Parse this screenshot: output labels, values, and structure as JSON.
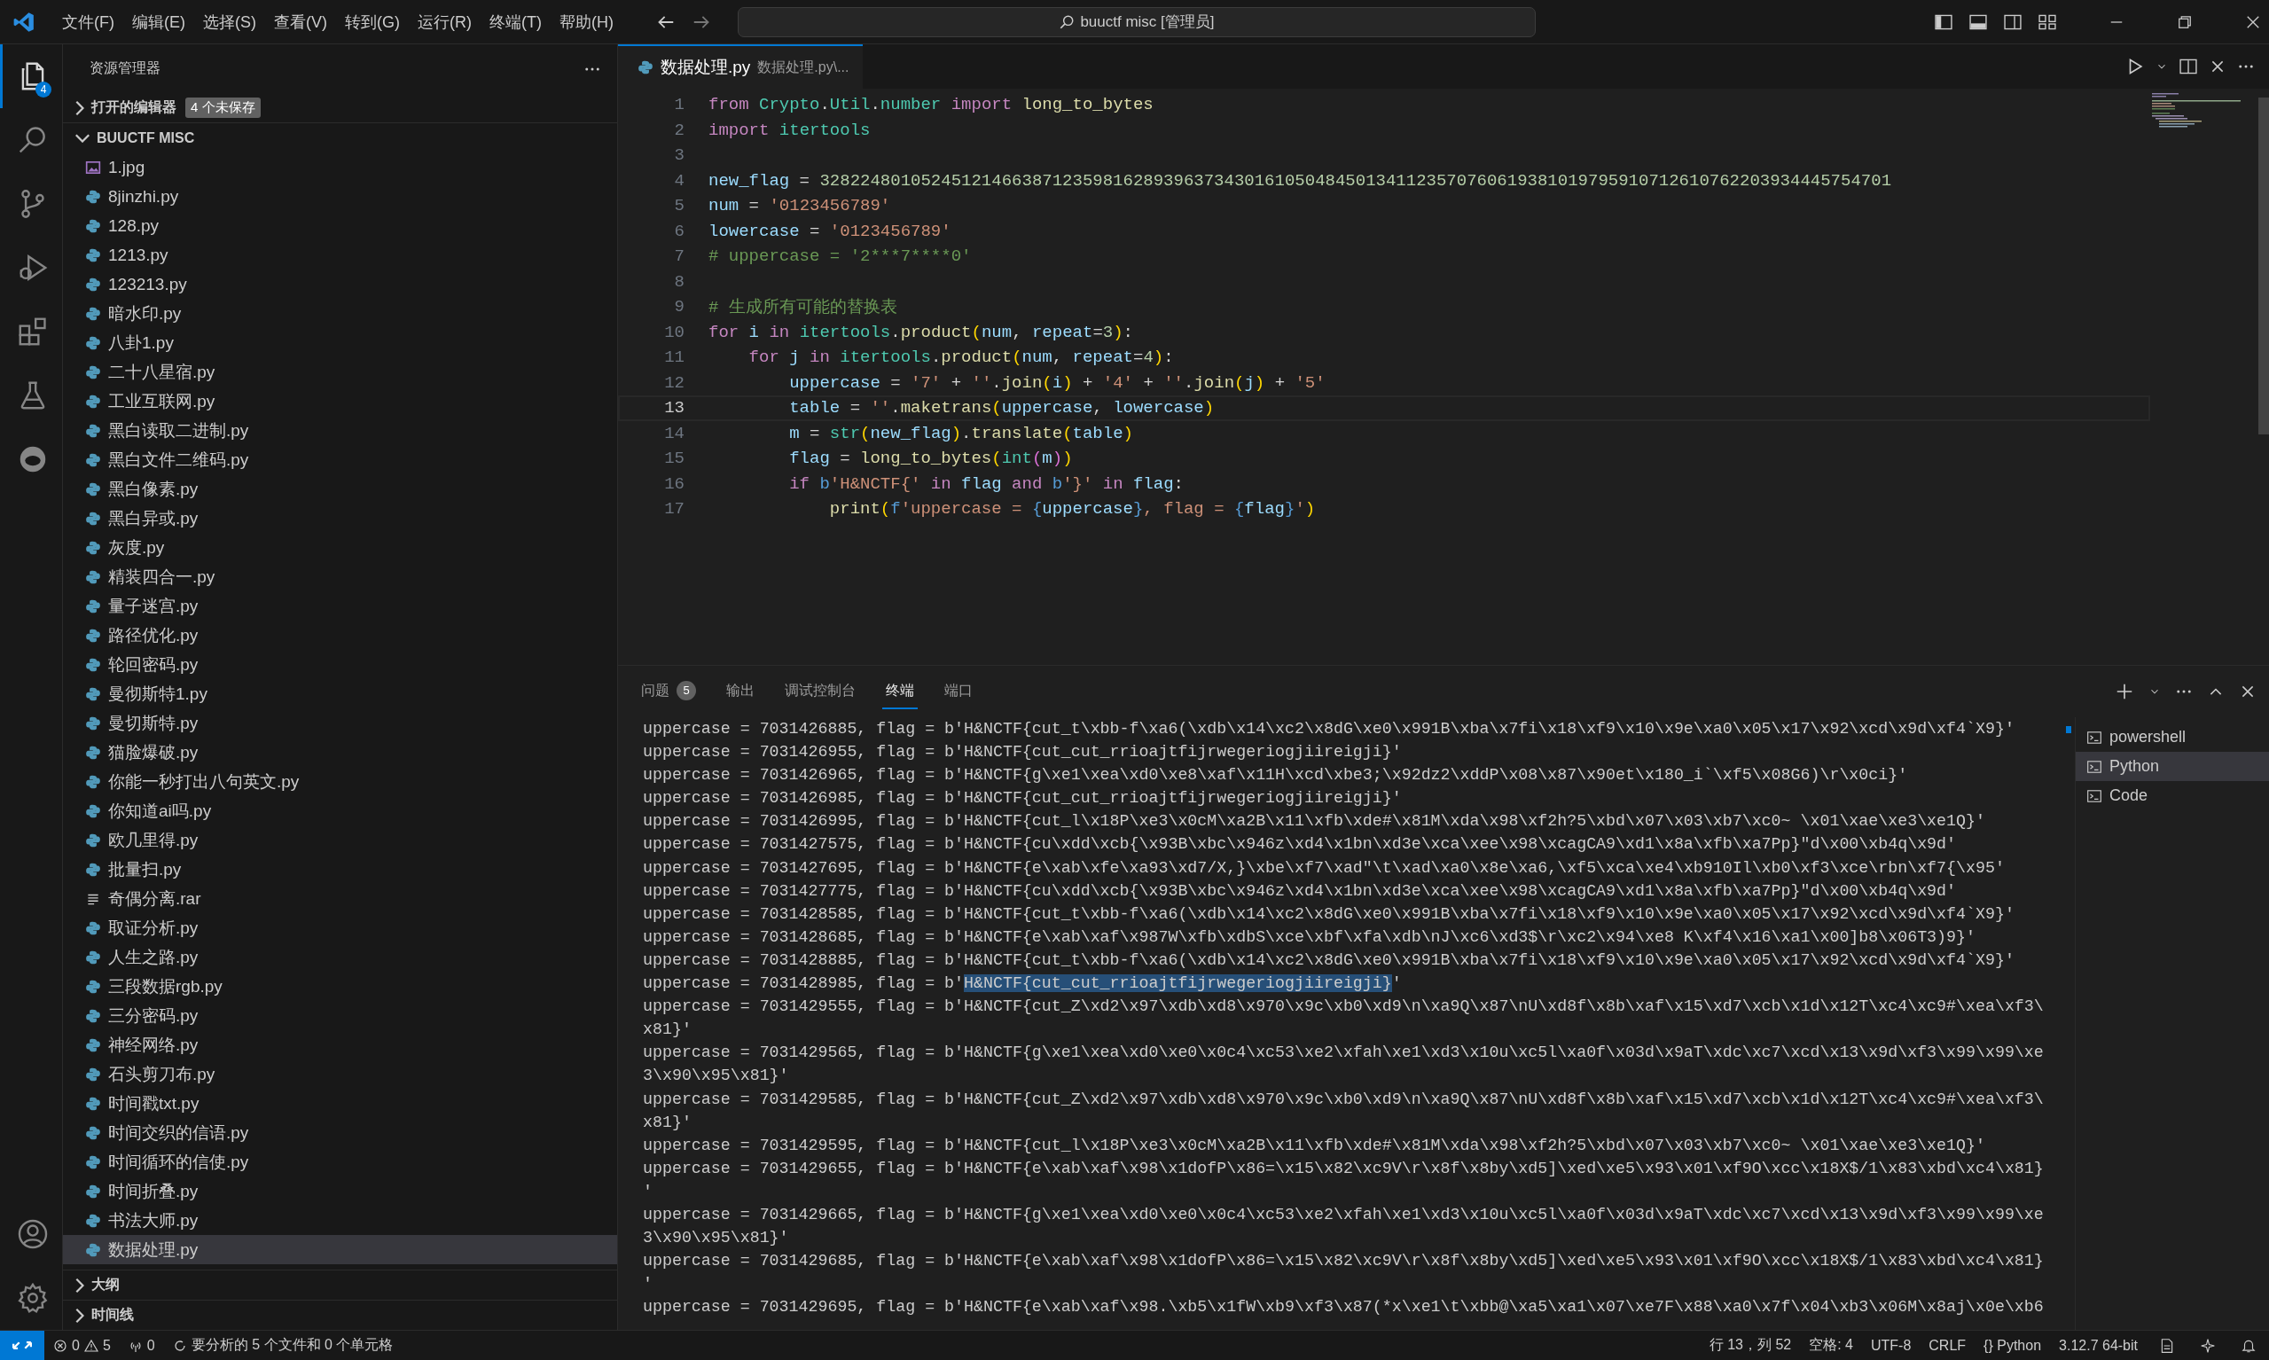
{
  "title_bar": {
    "menus": [
      "文件(F)",
      "编辑(E)",
      "选择(S)",
      "查看(V)",
      "转到(G)",
      "运行(R)",
      "终端(T)",
      "帮助(H)"
    ],
    "search": "buuctf misc [管理员]"
  },
  "activity_bar": {
    "items": [
      {
        "selected": true,
        "badge": "4"
      },
      {
        "selected": false
      },
      {
        "selected": false
      },
      {
        "selected": false
      },
      {
        "selected": false
      },
      {
        "selected": false
      },
      {
        "selected": false
      }
    ]
  },
  "sidebar": {
    "title": "资源管理器",
    "open_editors": {
      "label": "打开的编辑器",
      "badge": "4 个未保存",
      "expanded": false
    },
    "folder": {
      "label": "BUUCTF MISC",
      "expanded": true,
      "files": [
        {
          "name": "1.jpg",
          "kind": "image",
          "selected": false
        },
        {
          "name": "8jinzhi.py",
          "kind": "python",
          "selected": false
        },
        {
          "name": "128.py",
          "kind": "python",
          "selected": false
        },
        {
          "name": "1213.py",
          "kind": "python",
          "selected": false
        },
        {
          "name": "123213.py",
          "kind": "python",
          "selected": false
        },
        {
          "name": "暗水印.py",
          "kind": "python",
          "selected": false
        },
        {
          "name": "八卦1.py",
          "kind": "python",
          "selected": false
        },
        {
          "name": "二十八星宿.py",
          "kind": "python",
          "selected": false
        },
        {
          "name": "工业互联网.py",
          "kind": "python",
          "selected": false
        },
        {
          "name": "黑白读取二进制.py",
          "kind": "python",
          "selected": false
        },
        {
          "name": "黑白文件二维码.py",
          "kind": "python",
          "selected": false
        },
        {
          "name": "黑白像素.py",
          "kind": "python",
          "selected": false
        },
        {
          "name": "黑白异或.py",
          "kind": "python",
          "selected": false
        },
        {
          "name": "灰度.py",
          "kind": "python",
          "selected": false
        },
        {
          "name": "精装四合一.py",
          "kind": "python",
          "selected": false
        },
        {
          "name": "量子迷宫.py",
          "kind": "python",
          "selected": false
        },
        {
          "name": "路径优化.py",
          "kind": "python",
          "selected": false
        },
        {
          "name": "轮回密码.py",
          "kind": "python",
          "selected": false
        },
        {
          "name": "曼彻斯特1.py",
          "kind": "python",
          "selected": false
        },
        {
          "name": "曼切斯特.py",
          "kind": "python",
          "selected": false
        },
        {
          "name": "猫脸爆破.py",
          "kind": "python",
          "selected": false
        },
        {
          "name": "你能一秒打出八句英文.py",
          "kind": "python",
          "selected": false
        },
        {
          "name": "你知道ai吗.py",
          "kind": "python",
          "selected": false
        },
        {
          "name": "欧几里得.py",
          "kind": "python",
          "selected": false
        },
        {
          "name": "批量扫.py",
          "kind": "python",
          "selected": false
        },
        {
          "name": "奇偶分离.rar",
          "kind": "text",
          "selected": false
        },
        {
          "name": "取证分析.py",
          "kind": "python",
          "selected": false
        },
        {
          "name": "人生之路.py",
          "kind": "python",
          "selected": false
        },
        {
          "name": "三段数据rgb.py",
          "kind": "python",
          "selected": false
        },
        {
          "name": "三分密码.py",
          "kind": "python",
          "selected": false
        },
        {
          "name": "神经网络.py",
          "kind": "python",
          "selected": false
        },
        {
          "name": "石头剪刀布.py",
          "kind": "python",
          "selected": false
        },
        {
          "name": "时间戳txt.py",
          "kind": "python",
          "selected": false
        },
        {
          "name": "时间交织的信语.py",
          "kind": "python",
          "selected": false
        },
        {
          "name": "时间循环的信使.py",
          "kind": "python",
          "selected": false
        },
        {
          "name": "时间折叠.py",
          "kind": "python",
          "selected": false
        },
        {
          "name": "书法大师.py",
          "kind": "python",
          "selected": false
        },
        {
          "name": "数据处理.py",
          "kind": "python",
          "selected": true
        }
      ]
    },
    "sections": [
      {
        "label": "大纲",
        "expanded": false
      },
      {
        "label": "时间线",
        "expanded": false
      }
    ]
  },
  "editor": {
    "tab": {
      "title": "数据处理.py",
      "description": "数据处理.py\\..."
    },
    "lines": [
      {
        "number": "1",
        "current": false,
        "tokens": [
          {
            "text": "from",
            "kind": "keyword"
          },
          {
            "text": " Crypto",
            "kind": "module"
          },
          {
            "text": ".",
            "kind": "plain"
          },
          {
            "text": "Util",
            "kind": "module"
          },
          {
            "text": ".",
            "kind": "plain"
          },
          {
            "text": "number",
            "kind": "module"
          },
          {
            "text": " import",
            "kind": "keyword"
          },
          {
            "text": " long_to_bytes",
            "kind": "function"
          }
        ]
      },
      {
        "number": "2",
        "current": false,
        "tokens": [
          {
            "text": "import",
            "kind": "keyword"
          },
          {
            "text": " itertools",
            "kind": "module"
          }
        ]
      },
      {
        "number": "3",
        "current": false
      },
      {
        "number": "4",
        "current": false,
        "tokens": [
          {
            "text": "new_flag",
            "kind": "variable"
          },
          {
            "text": " = ",
            "kind": "plain"
          },
          {
            "text": "3282248010524512146638712359816289396373430161050484501341123570760619381019795910712610762203934445754701",
            "kind": "number"
          }
        ]
      },
      {
        "number": "5",
        "current": false,
        "tokens": [
          {
            "text": "num",
            "kind": "variable"
          },
          {
            "text": " = ",
            "kind": "plain"
          },
          {
            "text": "'0123456789'",
            "kind": "string"
          }
        ]
      },
      {
        "number": "6",
        "current": false,
        "tokens": [
          {
            "text": "lowercase",
            "kind": "variable"
          },
          {
            "text": " = ",
            "kind": "plain"
          },
          {
            "text": "'0123456789'",
            "kind": "string"
          }
        ]
      },
      {
        "number": "7",
        "current": false,
        "tokens": [
          {
            "text": "# uppercase = '2***7****0'",
            "kind": "comment"
          }
        ]
      },
      {
        "number": "8",
        "current": false
      },
      {
        "number": "9",
        "current": false,
        "tokens": [
          {
            "text": "# 生成所有可能的替换表",
            "kind": "comment"
          }
        ]
      },
      {
        "number": "10",
        "current": false,
        "tokens": [
          {
            "text": "for",
            "kind": "keyword"
          },
          {
            "text": " i",
            "kind": "variable"
          },
          {
            "text": " in",
            "kind": "keyword"
          },
          {
            "text": " itertools",
            "kind": "module"
          },
          {
            "text": ".",
            "kind": "plain"
          },
          {
            "text": "product",
            "kind": "function"
          },
          {
            "text": "(",
            "kind": "bracket"
          },
          {
            "text": "num",
            "kind": "variable"
          },
          {
            "text": ", ",
            "kind": "plain"
          },
          {
            "text": "repeat",
            "kind": "variable"
          },
          {
            "text": "=",
            "kind": "plain"
          },
          {
            "text": "3",
            "kind": "number"
          },
          {
            "text": ")",
            "kind": "bracket"
          },
          {
            "text": ":",
            "kind": "plain"
          }
        ]
      },
      {
        "number": "11",
        "current": false,
        "tokens": [
          {
            "text": "    for",
            "kind": "keyword"
          },
          {
            "text": " j",
            "kind": "variable"
          },
          {
            "text": " in",
            "kind": "keyword"
          },
          {
            "text": " itertools",
            "kind": "module"
          },
          {
            "text": ".",
            "kind": "plain"
          },
          {
            "text": "product",
            "kind": "function"
          },
          {
            "text": "(",
            "kind": "bracket"
          },
          {
            "text": "num",
            "kind": "variable"
          },
          {
            "text": ", ",
            "kind": "plain"
          },
          {
            "text": "repeat",
            "kind": "variable"
          },
          {
            "text": "=",
            "kind": "plain"
          },
          {
            "text": "4",
            "kind": "number"
          },
          {
            "text": ")",
            "kind": "bracket"
          },
          {
            "text": ":",
            "kind": "plain"
          }
        ]
      },
      {
        "number": "12",
        "current": false,
        "tokens": [
          {
            "text": "        uppercase",
            "kind": "variable"
          },
          {
            "text": " = ",
            "kind": "plain"
          },
          {
            "text": "'7'",
            "kind": "string"
          },
          {
            "text": " + ",
            "kind": "plain"
          },
          {
            "text": "''",
            "kind": "string"
          },
          {
            "text": ".",
            "kind": "plain"
          },
          {
            "text": "join",
            "kind": "function"
          },
          {
            "text": "(",
            "kind": "bracket"
          },
          {
            "text": "i",
            "kind": "variable"
          },
          {
            "text": ")",
            "kind": "bracket"
          },
          {
            "text": " + ",
            "kind": "plain"
          },
          {
            "text": "'4'",
            "kind": "string"
          },
          {
            "text": " + ",
            "kind": "plain"
          },
          {
            "text": "''",
            "kind": "string"
          },
          {
            "text": ".",
            "kind": "plain"
          },
          {
            "text": "join",
            "kind": "function"
          },
          {
            "text": "(",
            "kind": "bracket"
          },
          {
            "text": "j",
            "kind": "variable"
          },
          {
            "text": ")",
            "kind": "bracket"
          },
          {
            "text": " + ",
            "kind": "plain"
          },
          {
            "text": "'5'",
            "kind": "string"
          }
        ]
      },
      {
        "number": "13",
        "current": true,
        "tokens": [
          {
            "text": "        table",
            "kind": "variable"
          },
          {
            "text": " = ",
            "kind": "plain"
          },
          {
            "text": "''",
            "kind": "string"
          },
          {
            "text": ".",
            "kind": "plain"
          },
          {
            "text": "maketrans",
            "kind": "function"
          },
          {
            "text": "(",
            "kind": "bracket"
          },
          {
            "text": "uppercase",
            "kind": "variable"
          },
          {
            "text": ", ",
            "kind": "plain"
          },
          {
            "text": "lowercase",
            "kind": "variable"
          },
          {
            "text": ")",
            "kind": "bracket"
          }
        ]
      },
      {
        "number": "14",
        "current": false,
        "tokens": [
          {
            "text": "        m",
            "kind": "variable"
          },
          {
            "text": " = ",
            "kind": "plain"
          },
          {
            "text": "str",
            "kind": "module"
          },
          {
            "text": "(",
            "kind": "bracket"
          },
          {
            "text": "new_flag",
            "kind": "variable"
          },
          {
            "text": ")",
            "kind": "bracket"
          },
          {
            "text": ".",
            "kind": "plain"
          },
          {
            "text": "translate",
            "kind": "function"
          },
          {
            "text": "(",
            "kind": "bracket"
          },
          {
            "text": "table",
            "kind": "variable"
          },
          {
            "text": ")",
            "kind": "bracket"
          }
        ]
      },
      {
        "number": "15",
        "current": false,
        "tokens": [
          {
            "text": "        flag",
            "kind": "variable"
          },
          {
            "text": " = ",
            "kind": "plain"
          },
          {
            "text": "long_to_bytes",
            "kind": "function"
          },
          {
            "text": "(",
            "kind": "bracket"
          },
          {
            "text": "int",
            "kind": "module"
          },
          {
            "text": "(",
            "kind": "inner-bracket"
          },
          {
            "text": "m",
            "kind": "variable"
          },
          {
            "text": ")",
            "kind": "inner-bracket"
          },
          {
            "text": ")",
            "kind": "bracket"
          }
        ]
      },
      {
        "number": "16",
        "current": false,
        "tokens": [
          {
            "text": "        if",
            "kind": "keyword"
          },
          {
            "text": " b",
            "kind": "storage"
          },
          {
            "text": "'H&NCTF{'",
            "kind": "string"
          },
          {
            "text": " in",
            "kind": "keyword"
          },
          {
            "text": " flag",
            "kind": "variable"
          },
          {
            "text": " and",
            "kind": "keyword"
          },
          {
            "text": " b",
            "kind": "storage"
          },
          {
            "text": "'}'",
            "kind": "string"
          },
          {
            "text": " in",
            "kind": "keyword"
          },
          {
            "text": " flag",
            "kind": "variable"
          },
          {
            "text": ":",
            "kind": "plain"
          }
        ]
      },
      {
        "number": "17",
        "current": false,
        "tokens": [
          {
            "text": "            print",
            "kind": "function"
          },
          {
            "text": "(",
            "kind": "bracket"
          },
          {
            "text": "f",
            "kind": "storage"
          },
          {
            "text": "'uppercase = ",
            "kind": "string"
          },
          {
            "text": "{",
            "kind": "storage"
          },
          {
            "text": "uppercase",
            "kind": "variable"
          },
          {
            "text": "}",
            "kind": "storage"
          },
          {
            "text": ", flag = ",
            "kind": "string"
          },
          {
            "text": "{",
            "kind": "storage"
          },
          {
            "text": "flag",
            "kind": "variable"
          },
          {
            "text": "}",
            "kind": "storage"
          },
          {
            "text": "'",
            "kind": "string"
          },
          {
            "text": ")",
            "kind": "bracket"
          }
        ]
      }
    ]
  },
  "panel": {
    "tabs": [
      {
        "label": "问题",
        "badge": "5",
        "selected": false
      },
      {
        "label": "输出",
        "selected": false
      },
      {
        "label": "调试控制台",
        "selected": false
      },
      {
        "label": "终端",
        "selected": true
      },
      {
        "label": "端口",
        "selected": false
      }
    ],
    "terminal_lines": [
      [
        {
          "t": "uppercase = 7031426885, flag = b'H&NCTF{cut_t\\xbb-f\\xa6(\\xdb\\x14\\xc2\\x8dG\\xe0\\x991B\\xba\\x7fi\\x18\\xf9\\x10\\x9e\\xa0\\x05\\x17\\x92\\xcd\\x9d\\xf4`X9}'",
          "selected": false
        }
      ],
      [
        {
          "t": "uppercase = 7031426955, flag = b'H&NCTF{cut_cut_rrioajtfijrwegeriogjiireigji}'",
          "selected": false
        }
      ],
      [
        {
          "t": "uppercase = 7031426965, flag = b'H&NCTF{g\\xe1\\xea\\xd0\\xe8\\xaf\\x11H\\xcd\\xbe3;\\x92dz2\\xddP\\x08\\x87\\x90et\\x180_i`\\xf5\\x08G6)\\r\\x0ci}'",
          "selected": false
        }
      ],
      [
        {
          "t": "uppercase = 7031426985, flag = b'H&NCTF{cut_cut_rrioajtfijrwegeriogjiireigji}'",
          "selected": false
        }
      ],
      [
        {
          "t": "uppercase = 7031426995, flag = b'H&NCTF{cut_l\\x18P\\xe3\\x0cM\\xa2B\\x11\\xfb\\xde#\\x81M\\xda\\x98\\xf2h?5\\xbd\\x07\\x03\\xb7\\xc0~ \\x01\\xae\\xe3\\xe1Q}'",
          "selected": false
        }
      ],
      [
        {
          "t": "uppercase = 7031427575, flag = b'H&NCTF{cu\\xdd\\xcb{\\x93B\\xbc\\x946z\\xd4\\x1bn\\xd3e\\xca\\xee\\x98\\xcagCA9\\xd1\\x8a\\xfb\\xa7Pp}\"d\\x00\\xb4q\\x9d'",
          "selected": false
        }
      ],
      [
        {
          "t": "uppercase = 7031427695, flag = b'H&NCTF{e\\xab\\xfe\\xa93\\xd7/X,}\\xbe\\xf7\\xad\"\\t\\xad\\xa0\\x8e\\xa6,\\xf5\\xca\\xe4\\xb910Il\\xb0\\xf3\\xce\\rbn\\xf7{\\x95'",
          "selected": false
        }
      ],
      [
        {
          "t": "uppercase = 7031427775, flag = b'H&NCTF{cu\\xdd\\xcb{\\x93B\\xbc\\x946z\\xd4\\x1bn\\xd3e\\xca\\xee\\x98\\xcagCA9\\xd1\\x8a\\xfb\\xa7Pp}\"d\\x00\\xb4q\\x9d'",
          "selected": false
        }
      ],
      [
        {
          "t": "uppercase = 7031428585, flag = b'H&NCTF{cut_t\\xbb-f\\xa6(\\xdb\\x14\\xc2\\x8dG\\xe0\\x991B\\xba\\x7fi\\x18\\xf9\\x10\\x9e\\xa0\\x05\\x17\\x92\\xcd\\x9d\\xf4`X9}'",
          "selected": false
        }
      ],
      [
        {
          "t": "uppercase = 7031428685, flag = b'H&NCTF{e\\xab\\xaf\\x987W\\xfb\\xdbS\\xce\\xbf\\xfa\\xdb\\nJ\\xc6\\xd3$\\r\\xc2\\x94\\xe8 K\\xf4\\x16\\xa1\\x00]b8\\x06T3)9}'",
          "selected": false
        }
      ],
      [
        {
          "t": "uppercase = 7031428885, flag = b'H&NCTF{cut_t\\xbb-f\\xa6(\\xdb\\x14\\xc2\\x8dG\\xe0\\x991B\\xba\\x7fi\\x18\\xf9\\x10\\x9e\\xa0\\x05\\x17\\x92\\xcd\\x9d\\xf4`X9}'",
          "selected": false
        }
      ],
      [
        {
          "t": "uppercase = 7031428985, flag = b'",
          "selected": false
        },
        {
          "t": "H&NCTF{cut_cut_rrioajtfijrwegeriogjiireigji}",
          "selected": true
        },
        {
          "t": "'",
          "selected": false
        }
      ],
      [
        {
          "t": "uppercase = 7031429555, flag = b'H&NCTF{cut_Z\\xd2\\x97\\xdb\\xd8\\x970\\x9c\\xb0\\xd9\\n\\xa9Q\\x87\\nU\\xd8f\\x8b\\xaf\\x15\\xd7\\xcb\\x1d\\x12T\\xc4\\xc9#\\xea\\xf3\\",
          "selected": false
        }
      ],
      [
        {
          "t": "x81}'",
          "selected": false
        }
      ],
      [
        {
          "t": "uppercase = 7031429565, flag = b'H&NCTF{g\\xe1\\xea\\xd0\\xe0\\x0c4\\xc53\\xe2\\xfah\\xe1\\xd3\\x10u\\xc5l\\xa0f\\x03d\\x9aT\\xdc\\xc7\\xcd\\x13\\x9d\\xf3\\x99\\x99\\xe",
          "selected": false
        }
      ],
      [
        {
          "t": "3\\x90\\x95\\x81}'",
          "selected": false
        }
      ],
      [
        {
          "t": "uppercase = 7031429585, flag = b'H&NCTF{cut_Z\\xd2\\x97\\xdb\\xd8\\x970\\x9c\\xb0\\xd9\\n\\xa9Q\\x87\\nU\\xd8f\\x8b\\xaf\\x15\\xd7\\xcb\\x1d\\x12T\\xc4\\xc9#\\xea\\xf3\\",
          "selected": false
        }
      ],
      [
        {
          "t": "x81}'",
          "selected": false
        }
      ],
      [
        {
          "t": "uppercase = 7031429595, flag = b'H&NCTF{cut_l\\x18P\\xe3\\x0cM\\xa2B\\x11\\xfb\\xde#\\x81M\\xda\\x98\\xf2h?5\\xbd\\x07\\x03\\xb7\\xc0~ \\x01\\xae\\xe3\\xe1Q}'",
          "selected": false
        }
      ],
      [
        {
          "t": "uppercase = 7031429655, flag = b'H&NCTF{e\\xab\\xaf\\x98\\x1dofP\\x86=\\x15\\x82\\xc9V\\r\\x8f\\x8by\\xd5]\\xed\\xe5\\x93\\x01\\xf9O\\xcc\\x18X$/1\\x83\\xbd\\xc4\\x81}",
          "selected": false
        }
      ],
      [
        {
          "t": "'",
          "selected": false
        }
      ],
      [
        {
          "t": "uppercase = 7031429665, flag = b'H&NCTF{g\\xe1\\xea\\xd0\\xe0\\x0c4\\xc53\\xe2\\xfah\\xe1\\xd3\\x10u\\xc5l\\xa0f\\x03d\\x9aT\\xdc\\xc7\\xcd\\x13\\x9d\\xf3\\x99\\x99\\xe",
          "selected": false
        }
      ],
      [
        {
          "t": "3\\x90\\x95\\x81}'",
          "selected": false
        }
      ],
      [
        {
          "t": "uppercase = 7031429685, flag = b'H&NCTF{e\\xab\\xaf\\x98\\x1dofP\\x86=\\x15\\x82\\xc9V\\r\\x8f\\x8by\\xd5]\\xed\\xe5\\x93\\x01\\xf9O\\xcc\\x18X$/1\\x83\\xbd\\xc4\\x81}",
          "selected": false
        }
      ],
      [
        {
          "t": "'",
          "selected": false
        }
      ],
      [
        {
          "t": "uppercase = 7031429695, flag = b'H&NCTF{e\\xab\\xaf\\x98.\\xb5\\x1fW\\xb9\\xf3\\x87(*x\\xe1\\t\\xbb@\\xa5\\xa1\\x07\\xe7F\\x88\\xa0\\x7f\\x04\\xb3\\x06M\\x8aj\\x0e\\xb6",
          "selected": false
        }
      ]
    ],
    "terminals": [
      {
        "name": "powershell",
        "selected": false
      },
      {
        "name": "Python",
        "selected": true
      },
      {
        "name": "Code",
        "selected": false
      }
    ]
  },
  "status_bar": {
    "errors": "0",
    "warnings": "5",
    "ports": "0",
    "analysis": "要分析的 5 个文件和 0 个单元格",
    "right": [
      "行 13，列 52",
      "空格: 4",
      "UTF-8",
      "CRLF",
      "{} Python",
      "3.12.7 64-bit"
    ]
  }
}
